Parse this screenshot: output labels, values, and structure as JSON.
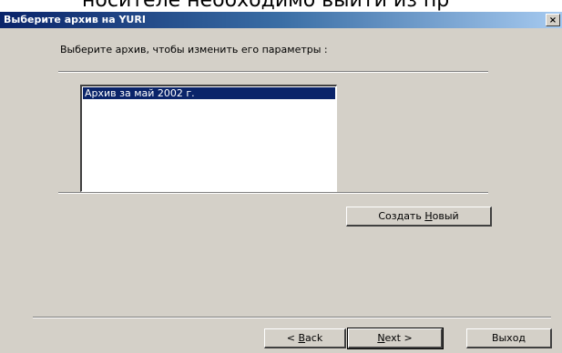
{
  "background_text": "носителе необходимо выйти из пр",
  "dialog": {
    "title": "Выберите архив на YURI",
    "close_glyph": "×",
    "prompt": "Выберите архив, чтобы изменить его параметры :",
    "archives": [
      {
        "label": "Архив за май 2002 г.",
        "selected": true
      }
    ],
    "create_new": {
      "prefix": "Создать ",
      "mnemonic": "Н",
      "suffix": "овый"
    },
    "back": {
      "prefix": "< ",
      "mnemonic": "B",
      "suffix": "ack"
    },
    "next": {
      "prefix": "",
      "mnemonic": "N",
      "suffix": "ext >"
    },
    "exit_label": "Выход"
  },
  "colors": {
    "titlebar_start": "#0a246a",
    "titlebar_end": "#a6caf0",
    "window_face": "#d4d0c8",
    "selection": "#0a246a"
  }
}
